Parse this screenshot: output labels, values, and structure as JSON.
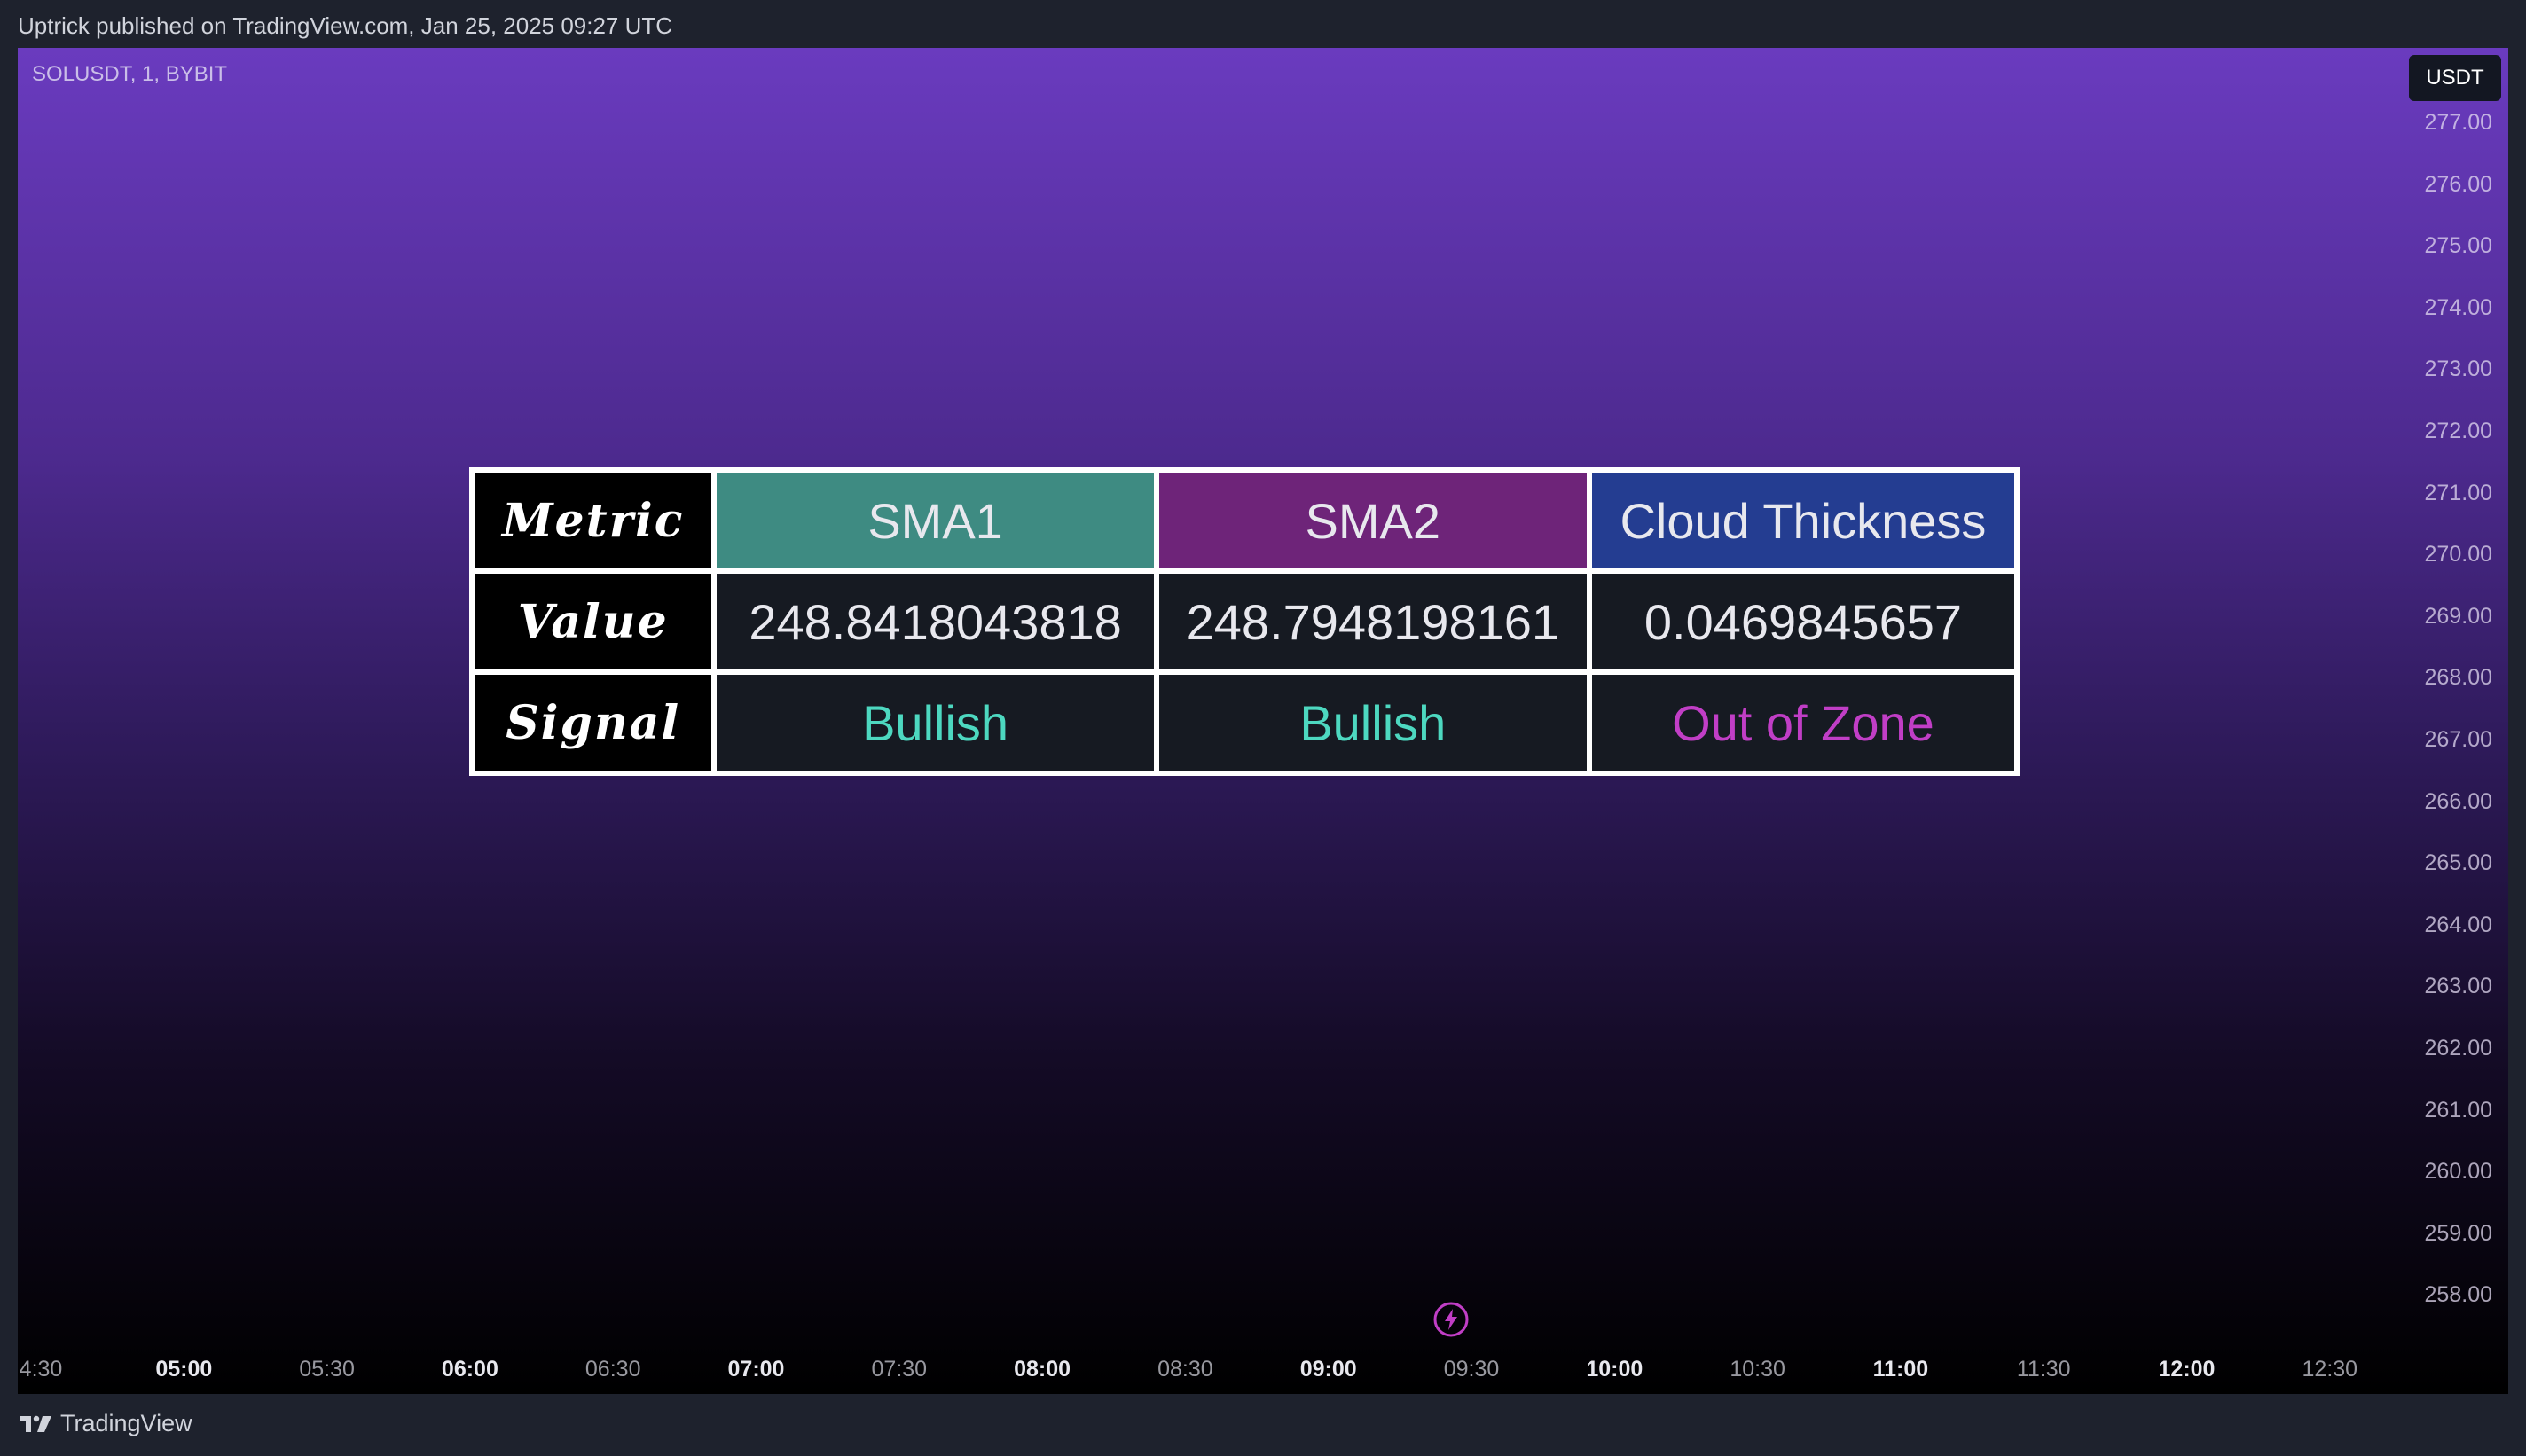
{
  "publish_info": "Uptrick published on TradingView.com, Jan 25, 2025 09:27 UTC",
  "symbol_label": "SOLUSDT, 1, BYBIT",
  "currency": "USDT",
  "price_axis": [
    "277.00",
    "276.00",
    "275.00",
    "274.00",
    "273.00",
    "272.00",
    "271.00",
    "270.00",
    "269.00",
    "268.00",
    "267.00",
    "266.00",
    "265.00",
    "264.00",
    "263.00",
    "262.00",
    "261.00",
    "260.00",
    "259.00",
    "258.00"
  ],
  "time_axis": [
    {
      "label": "4:30",
      "major": false
    },
    {
      "label": "05:00",
      "major": true
    },
    {
      "label": "05:30",
      "major": false
    },
    {
      "label": "06:00",
      "major": true
    },
    {
      "label": "06:30",
      "major": false
    },
    {
      "label": "07:00",
      "major": true
    },
    {
      "label": "07:30",
      "major": false
    },
    {
      "label": "08:00",
      "major": true
    },
    {
      "label": "08:30",
      "major": false
    },
    {
      "label": "09:00",
      "major": true
    },
    {
      "label": "09:30",
      "major": false
    },
    {
      "label": "10:00",
      "major": true
    },
    {
      "label": "10:30",
      "major": false
    },
    {
      "label": "11:00",
      "major": true
    },
    {
      "label": "11:30",
      "major": false
    },
    {
      "label": "12:00",
      "major": true
    },
    {
      "label": "12:30",
      "major": false
    }
  ],
  "table": {
    "header": {
      "label": "Metric",
      "sma1": "SMA1",
      "sma2": "SMA2",
      "cloud": "Cloud Thickness"
    },
    "value_row": {
      "label": "Value",
      "sma1": "248.8418043818",
      "sma2": "248.7948198161",
      "cloud": "0.0469845657"
    },
    "signal_row": {
      "label": "Signal",
      "sma1": "Bullish",
      "sma2": "Bullish",
      "cloud": "Out of Zone"
    }
  },
  "colors": {
    "sma1_header": "#3e8b82",
    "sma2_header": "#6e2479",
    "cloud_header": "#243d91",
    "bullish": "#4dd8c0",
    "out_of_zone": "#c13ec6"
  },
  "icons": {
    "event": "lightning-icon",
    "brand": "tradingview-logo-icon"
  },
  "brand_name": "TradingView"
}
